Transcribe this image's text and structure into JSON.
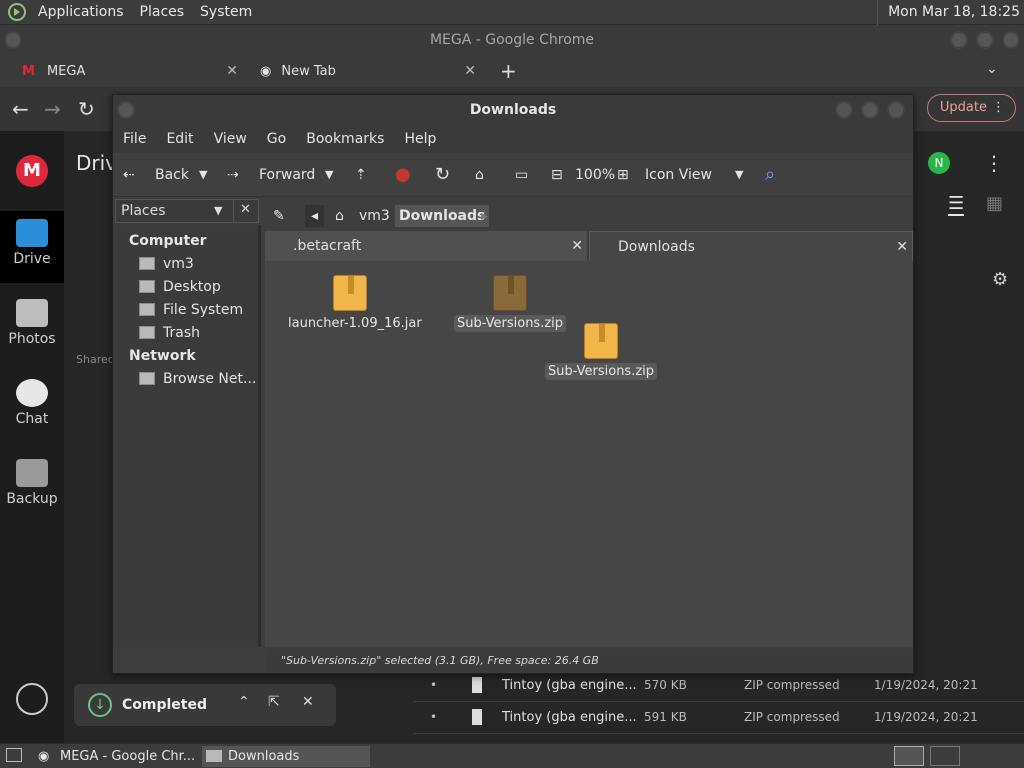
{
  "top_panel": {
    "menus": [
      "Applications",
      "Places",
      "System"
    ],
    "clock": "Mon Mar 18, 18:25"
  },
  "chrome": {
    "title": "MEGA - Google Chrome",
    "tabs": [
      {
        "label": "MEGA"
      },
      {
        "label": "New Tab"
      }
    ],
    "new_tab": "+",
    "update_label": "Update"
  },
  "mega": {
    "logo": "M",
    "page_title": "Driv",
    "nav": [
      {
        "label": "Drive"
      },
      {
        "label": "Photos"
      },
      {
        "label": "Chat"
      },
      {
        "label": "Backup"
      }
    ],
    "shared_label": "Shared",
    "avatar": "N",
    "rows": [
      {
        "name": "Tintoy (gba engine...",
        "size": "570 KB",
        "type": "ZIP compressed",
        "date": "1/19/2024, 20:21"
      },
      {
        "name": "Tintoy (gba engine...",
        "size": "591 KB",
        "type": "ZIP compressed",
        "date": "1/19/2024, 20:21"
      }
    ],
    "toast": "Completed"
  },
  "file_manager": {
    "title": "Downloads",
    "menus": [
      "File",
      "Edit",
      "View",
      "Go",
      "Bookmarks",
      "Help"
    ],
    "toolbar": {
      "back": "Back",
      "forward": "Forward",
      "zoom": "100%",
      "view_mode": "Icon View"
    },
    "places_label": "Places",
    "sidebar": {
      "computer_header": "Computer",
      "computer_items": [
        "vm3",
        "Desktop",
        "File System",
        "Trash"
      ],
      "network_header": "Network",
      "network_items": [
        "Browse Net..."
      ]
    },
    "breadcrumb": [
      "vm3",
      "Downloads"
    ],
    "tabs": [
      {
        "label": ".betacraft"
      },
      {
        "label": "Downloads"
      }
    ],
    "files": [
      {
        "name": "launcher-1.09_16.jar"
      },
      {
        "name": "Sub-Versions.zip"
      },
      {
        "name": "Sub-Versions.zip"
      }
    ],
    "status": "\"Sub-Versions.zip\" selected (3.1 GB), Free space: 26.4 GB"
  },
  "taskbar": {
    "items": [
      {
        "label": "MEGA - Google Chr..."
      },
      {
        "label": "Downloads"
      }
    ]
  }
}
